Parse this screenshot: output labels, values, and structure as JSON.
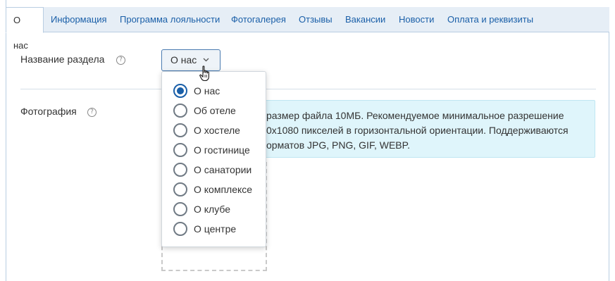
{
  "tabs": [
    {
      "label": "О нас",
      "active": true
    },
    {
      "label": "Информация"
    },
    {
      "label": "Программа лояльности"
    },
    {
      "label": "Фотогалерея"
    },
    {
      "label": "Отзывы"
    },
    {
      "label": "Вакансии"
    },
    {
      "label": "Новости"
    },
    {
      "label": "Оплата и реквизиты"
    }
  ],
  "form": {
    "section_name_label": "Название раздела",
    "photo_label": "Фотография",
    "help_glyph": "?",
    "select_value": "О нас",
    "info_lines": [
      "размер файла 10МБ. Рекомендуемое минимальное разрешение",
      "0x1080 пикселей в горизонтальной ориентации. Поддерживаются",
      "орматов JPG, PNG, GIF, WEBP."
    ]
  },
  "dropdown": {
    "options": [
      {
        "label": "О нас",
        "selected": true
      },
      {
        "label": "Об отеле"
      },
      {
        "label": "О хостеле"
      },
      {
        "label": "О гостинице"
      },
      {
        "label": "О санатории"
      },
      {
        "label": "О комплексе"
      },
      {
        "label": "О клубе"
      },
      {
        "label": "О центре"
      }
    ]
  },
  "colors": {
    "accent": "#1a5fa8",
    "tabbar_bg": "#e6eef6",
    "info_bg": "#dff5fb"
  },
  "icons": {
    "help": "question-circle-icon",
    "chevron": "chevron-down-icon",
    "cursor": "hand-pointer-icon"
  }
}
